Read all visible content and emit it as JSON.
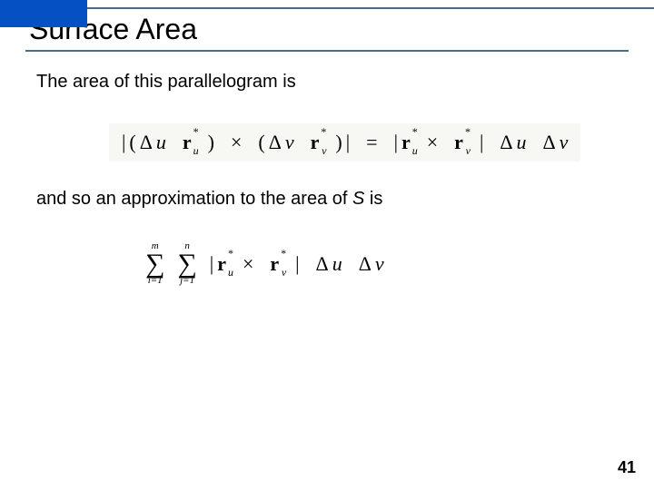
{
  "header": {
    "title": "Surface Area"
  },
  "body": {
    "p1": "The area of this parallelogram is",
    "p2_prefix": "and so an approximation to the area of ",
    "p2_var": "S",
    "p2_suffix": " is"
  },
  "eq1": {
    "lbar1": "|",
    "lp": "(",
    "du": "Δ",
    "u": "u",
    "r": "r",
    "rp": ")",
    "cross": "×",
    "lp2": "(",
    "dv": "Δ",
    "v": "v",
    "rp2": ")",
    "rbar1": "|",
    "eq": "=",
    "lbar2": "|",
    "rbar2": "|",
    "star": "*"
  },
  "eq2": {
    "outer_top": "m",
    "outer_bot": "i=1",
    "inner_top": "n",
    "inner_bot": "j=1",
    "sigma": "∑",
    "lbar": "|",
    "r": "r",
    "cross": "×",
    "rbar": "|",
    "du": "Δ",
    "u": "u",
    "dv": "Δ",
    "v": "v",
    "star": "*",
    "sub_u": "u",
    "sub_v": "v"
  },
  "page": "41"
}
